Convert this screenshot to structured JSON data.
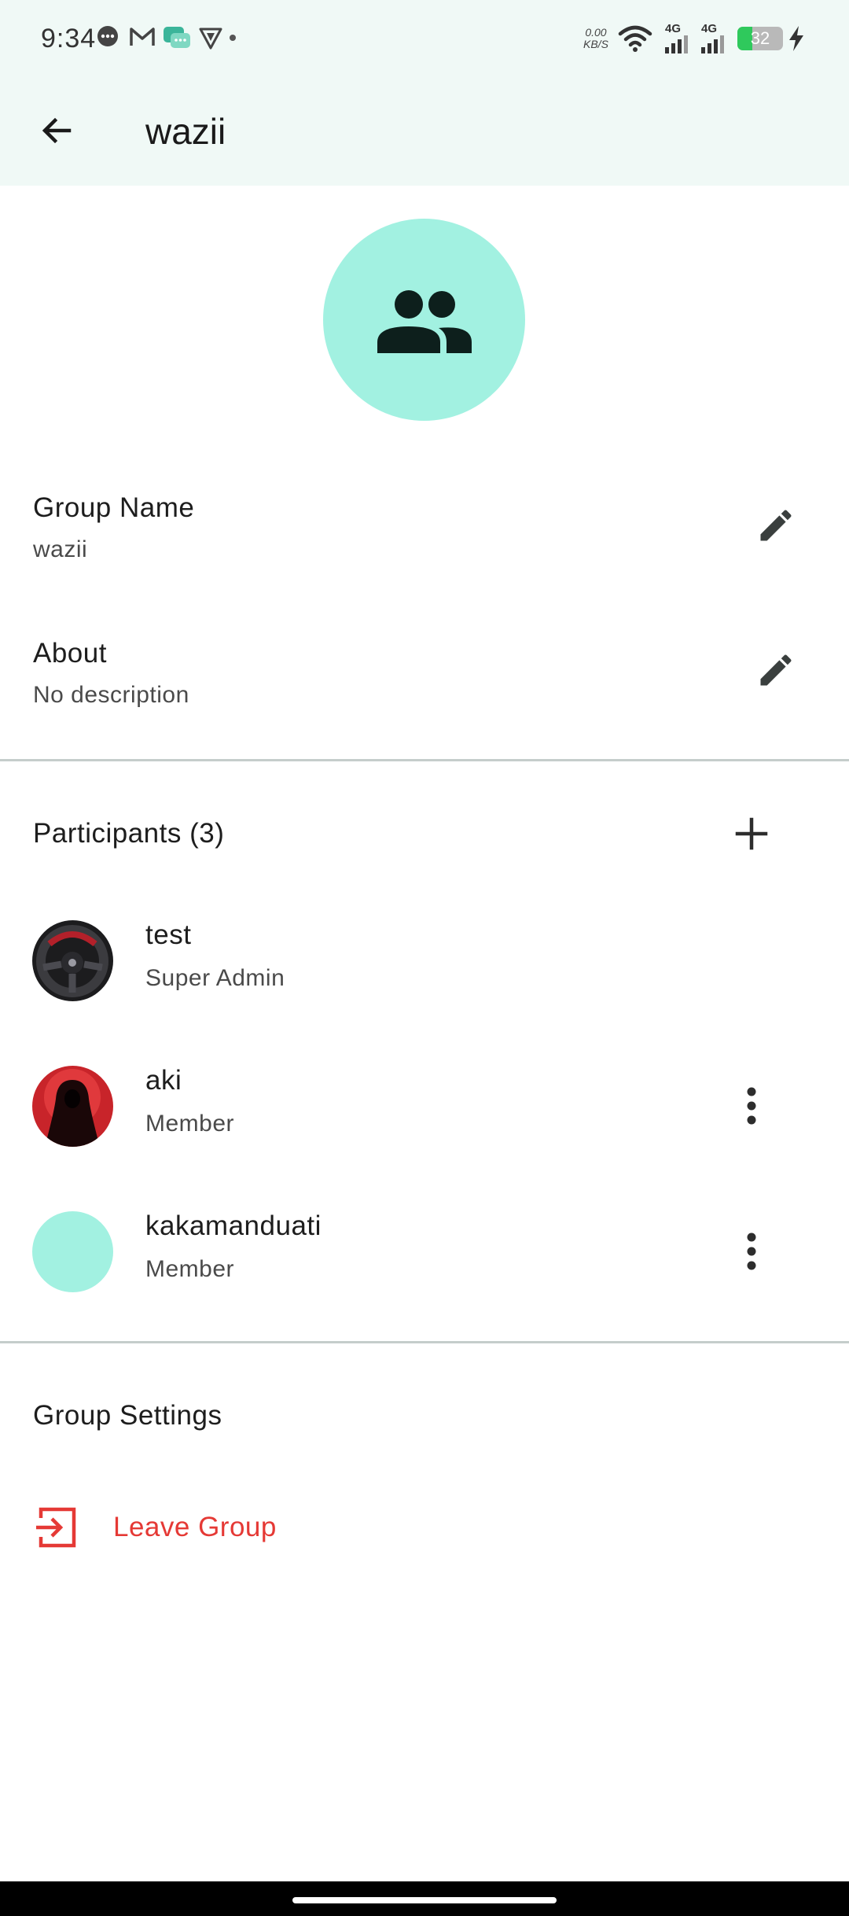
{
  "status_bar": {
    "time": "9:34",
    "net_speed_value": "0.00",
    "net_speed_unit": "KB/S",
    "signal_1": "4G",
    "signal_2": "4G",
    "battery_level": "32",
    "battery_fraction": 0.32,
    "icons": [
      "chat-bubble-icon",
      "gmail-icon",
      "messages-icon",
      "vpn-shield-icon",
      "dot-icon",
      "wifi-icon",
      "signal-icon",
      "battery-icon",
      "charging-bolt-icon"
    ]
  },
  "app_bar": {
    "title": "wazii",
    "back_icon": "arrow-back-icon"
  },
  "group": {
    "avatar_icon": "group-icon",
    "name_label": "Group Name",
    "name_value": "wazii",
    "about_label": "About",
    "about_value": "No description"
  },
  "participants": {
    "header": "Participants (3)",
    "list": [
      {
        "name": "test",
        "role": "Super Admin",
        "avatar": "steering-wheel-photo"
      },
      {
        "name": "aki",
        "role": "Member",
        "avatar": "hooded-figure-photo"
      },
      {
        "name": "kakamanduati",
        "role": "Member",
        "avatar": "plain-avatar"
      }
    ]
  },
  "settings": {
    "header": "Group Settings",
    "leave_label": "Leave Group"
  },
  "colors": {
    "accent": "#a2f1e1",
    "danger": "#e53935",
    "header_bg": "#f0f9f6",
    "battery_green": "#2fc95c"
  }
}
